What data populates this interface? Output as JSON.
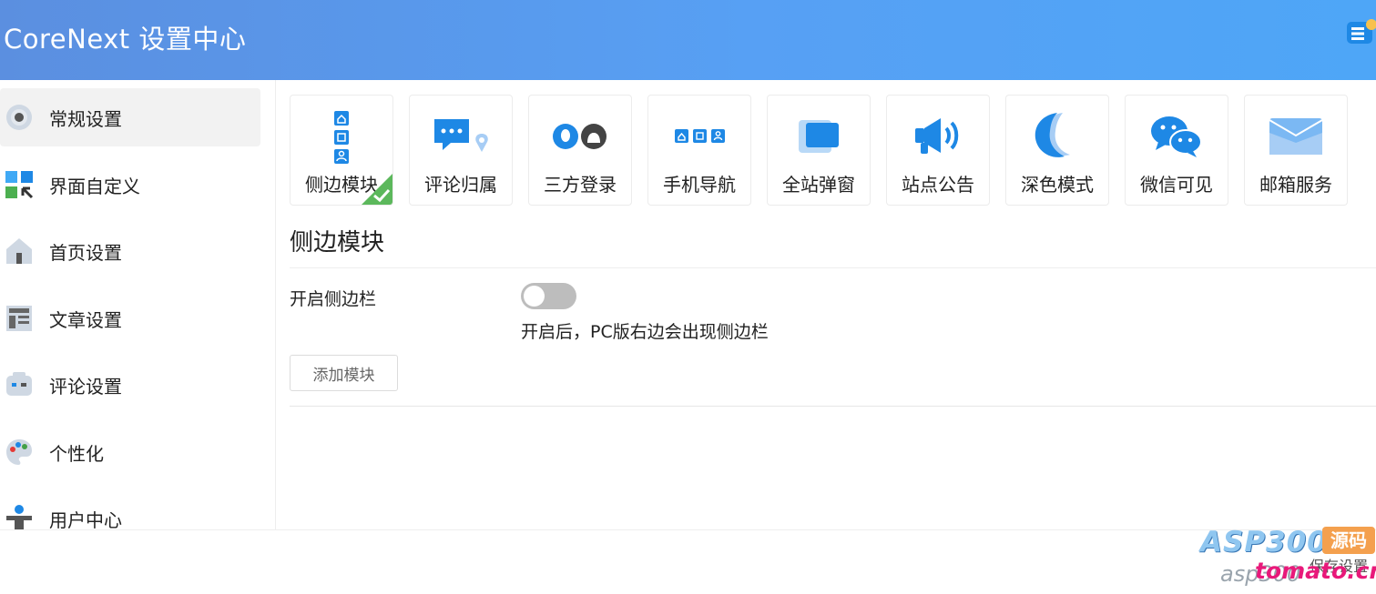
{
  "header": {
    "title": "CoreNext 设置中心"
  },
  "sidebar": {
    "items": [
      {
        "label": "常规设置",
        "icon": "gear-icon",
        "active": true
      },
      {
        "label": "界面自定义",
        "icon": "layout-customize-icon"
      },
      {
        "label": "首页设置",
        "icon": "home-icon"
      },
      {
        "label": "文章设置",
        "icon": "article-icon"
      },
      {
        "label": "评论设置",
        "icon": "comment-bot-icon"
      },
      {
        "label": "个性化",
        "icon": "palette-icon"
      },
      {
        "label": "用户中心",
        "icon": "user-icon"
      }
    ]
  },
  "tabs": [
    {
      "label": "侧边模块",
      "icon": "side-module-icon",
      "selected": true
    },
    {
      "label": "评论归属",
      "icon": "comment-location-icon"
    },
    {
      "label": "三方登录",
      "icon": "third-party-login-icon"
    },
    {
      "label": "手机导航",
      "icon": "mobile-nav-icon"
    },
    {
      "label": "全站弹窗",
      "icon": "popup-window-icon"
    },
    {
      "label": "站点公告",
      "icon": "megaphone-icon"
    },
    {
      "label": "深色模式",
      "icon": "moon-icon"
    },
    {
      "label": "微信可见",
      "icon": "wechat-icon"
    },
    {
      "label": "邮箱服务",
      "icon": "mail-icon"
    }
  ],
  "section": {
    "title": "侧边模块",
    "option_label": "开启侧边栏",
    "toggle_on": false,
    "description": "开启后，PC版右边会出现侧边栏",
    "add_button": "添加模块"
  },
  "footer": {
    "save_button": "保存设置"
  },
  "watermark": {
    "logo": "ASP300",
    "badge": "源码",
    "url_gray": "asp300",
    "url_pink": "tomato.cm"
  },
  "colors": {
    "accent": "#1e88e5",
    "header_start": "#5b8fe0",
    "header_end": "#4ea6f7",
    "check": "#5cb85c"
  }
}
